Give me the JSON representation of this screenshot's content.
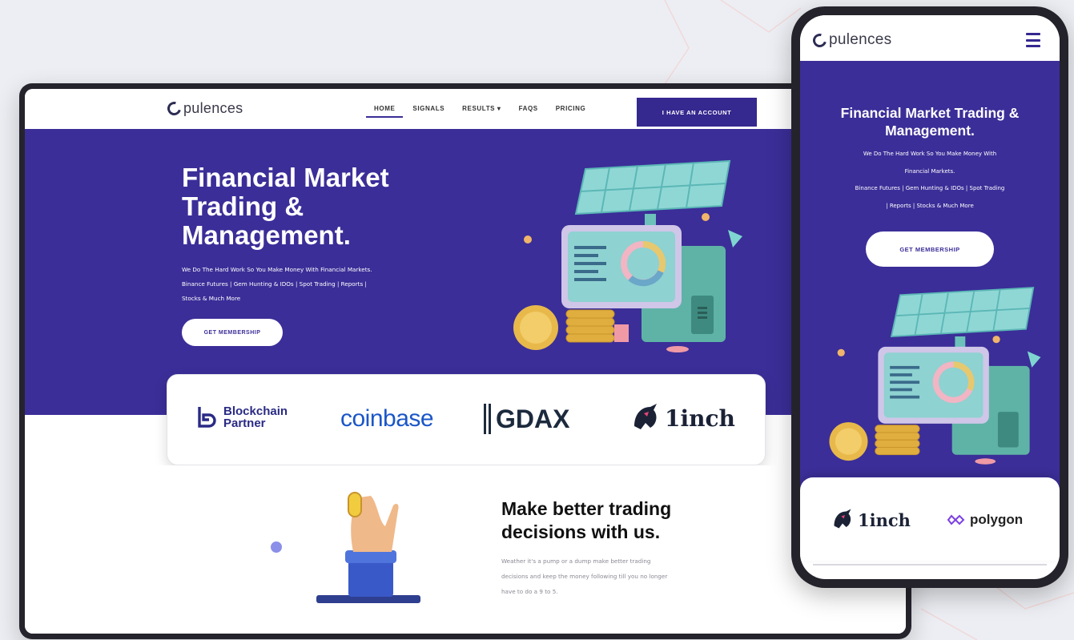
{
  "desktop": {
    "nav": {
      "logo": "pulences",
      "menu": [
        "HOME",
        "SIGNALS",
        "RESULTS ▾",
        "FAQS",
        "PRICING"
      ],
      "cta": "I HAVE AN ACCOUNT"
    },
    "hero": {
      "title_lines": [
        "Financial Market",
        "Trading &",
        "Management."
      ],
      "subtitle_lines": [
        "We Do The Hard Work So You Make Money With Financial Markets.",
        "Binance Futures | Gem Hunting & IDOs | Spot Trading | Reports |",
        "Stocks & Much More"
      ],
      "button": "GET MEMBERSHIP"
    },
    "brands": {
      "blockchain_line1": "Blockchain",
      "blockchain_line2": "Partner",
      "coinbase": "coinbase",
      "gdax": "GDAX",
      "oneinch": "1inch"
    },
    "feature": {
      "title_lines": [
        "Make better trading",
        "decisions with us."
      ],
      "text_lines": [
        "Weather it's a pump or a dump make better trading",
        "decisions and keep the money following till you no longer",
        "have to do a 9 to 5."
      ]
    }
  },
  "mobile": {
    "nav": {
      "logo": "pulences"
    },
    "hero": {
      "title_lines": [
        "Financial Market Trading &",
        "Management."
      ],
      "subtitle_lines": [
        "We Do The Hard Work So You Make Money With",
        "Financial Markets.",
        "Binance Futures | Gem Hunting & IDOs | Spot Trading",
        "| Reports | Stocks & Much More"
      ],
      "button": "GET MEMBERSHIP"
    },
    "brands": {
      "oneinch": "1inch",
      "polygon": "polygon"
    }
  },
  "colors": {
    "brand_purple": "#3b2e98",
    "cta_purple": "#35288f",
    "coinbase_blue": "#1b56c7",
    "device_frame": "#25242c"
  },
  "icons": [
    "logo-c-icon",
    "chevron-down-icon",
    "hamburger-icon",
    "blockchain-partner-icon",
    "gdax-bars-icon",
    "unicorn-icon",
    "polygon-icon"
  ]
}
